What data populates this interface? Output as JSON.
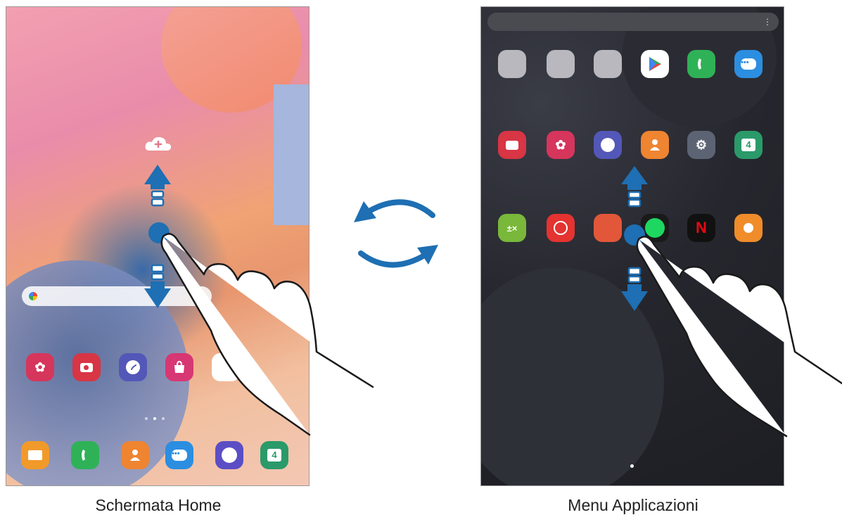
{
  "captions": {
    "home": "Schermata Home",
    "apps": "Menu Applicazioni"
  },
  "home_screen": {
    "widget_icon": "cloud-plus-icon",
    "search_bar_icon": "google-g-icon",
    "app_row_icons": [
      "gallery-icon",
      "camera-icon",
      "clock-icon",
      "galaxy-store-icon",
      "play-store-icon"
    ],
    "dock_icons": [
      "my-files-icon",
      "phone-icon",
      "contacts-icon",
      "messages-icon",
      "internet-icon",
      "calendar-icon"
    ],
    "calendar_day": "4"
  },
  "apps_screen": {
    "rows": [
      [
        "samsung-folder-icon",
        "google-folder-icon",
        "microsoft-folder-icon",
        "play-store-icon",
        "phone-icon",
        "messages-icon"
      ],
      [
        "camera-icon",
        "gallery-icon",
        "clock-icon",
        "contacts-icon",
        "settings-icon",
        "calendar-icon"
      ],
      [
        "calculator-icon",
        "youtube-music-icon",
        "samsung-notes-icon",
        "spotify-icon",
        "netflix-icon",
        "tips-icon"
      ]
    ],
    "calendar_day": "4"
  },
  "colors": {
    "arrow_blue": "#1e6fb3",
    "rotate_arrows": "#1e6fb3"
  }
}
